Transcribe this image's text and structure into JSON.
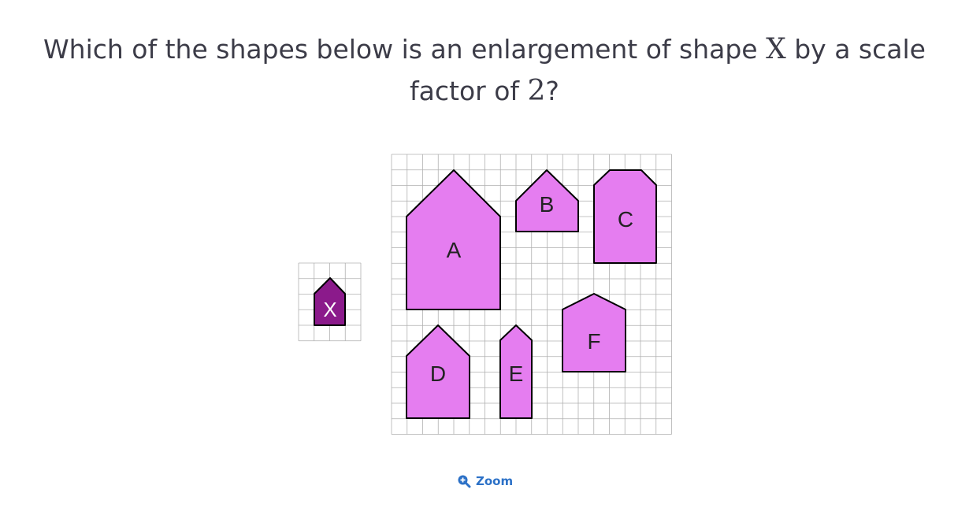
{
  "question": {
    "prefix": "Which of the shapes below is an enlargement of shape ",
    "shape_var": "X",
    "middle": " by a scale",
    "line2_prefix": "factor of ",
    "factor": "2",
    "suffix": "?"
  },
  "figure": {
    "reference_shape_label": "X",
    "reference_color": "#8b1a8b",
    "option_color": "#e57df0",
    "grid_line_color": "#b0b0b0",
    "options": [
      {
        "label": "A"
      },
      {
        "label": "B"
      },
      {
        "label": "C"
      },
      {
        "label": "D"
      },
      {
        "label": "E"
      },
      {
        "label": "F"
      }
    ]
  },
  "zoom": {
    "label": "Zoom",
    "icon": "zoom-in-icon",
    "color": "#2c71c7"
  }
}
